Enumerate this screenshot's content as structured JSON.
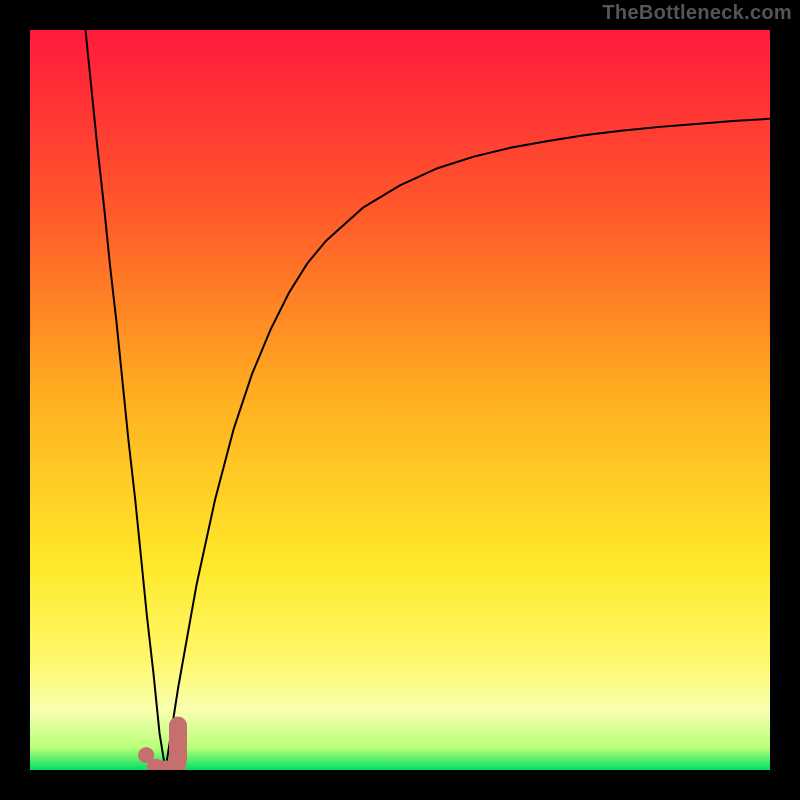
{
  "watermark": "TheBottleneck.com",
  "chart_data": {
    "type": "line",
    "title": "",
    "xlabel": "",
    "ylabel": "",
    "xlim": [
      0,
      100
    ],
    "ylim": [
      0,
      100
    ],
    "grid": false,
    "legend": false,
    "series": [
      {
        "name": "left-branch",
        "stroke": "#000000",
        "x": [
          7.5,
          8.3,
          9.1,
          10.0,
          10.8,
          11.7,
          12.5,
          13.3,
          14.2,
          15.0,
          15.8,
          16.7,
          17.5,
          18.3
        ],
        "values": [
          100,
          92.1,
          84.2,
          76.2,
          68.3,
          60.4,
          52.5,
          44.6,
          36.7,
          28.8,
          20.8,
          12.9,
          5.0,
          0.0
        ]
      },
      {
        "name": "right-curve",
        "stroke": "#000000",
        "x": [
          18.3,
          20.0,
          22.5,
          25.0,
          27.5,
          30.0,
          32.5,
          35.0,
          37.5,
          40.0,
          45.0,
          50.0,
          55.0,
          60.0,
          65.0,
          70.0,
          75.0,
          80.0,
          85.0,
          90.0,
          95.0,
          100.0
        ],
        "values": [
          0.0,
          11.0,
          25.0,
          36.5,
          46.0,
          53.5,
          59.5,
          64.5,
          68.5,
          71.5,
          76.0,
          79.0,
          81.3,
          82.9,
          84.1,
          85.0,
          85.8,
          86.4,
          86.9,
          87.3,
          87.7,
          88.0
        ]
      },
      {
        "name": "j-marker",
        "stroke": "#c76e6e",
        "x": [
          17.0,
          17.2,
          17.4,
          17.8,
          18.5,
          19.2,
          19.8,
          20.0,
          20.0,
          20.0,
          20.0
        ],
        "values": [
          0.3,
          0.2,
          0.1,
          0.05,
          0.05,
          0.1,
          0.5,
          1.5,
          3.0,
          4.5,
          6.0
        ]
      },
      {
        "name": "dot-marker",
        "stroke": "#c76e6e",
        "x": [
          15.7
        ],
        "values": [
          2.0
        ]
      }
    ],
    "background_gradient": {
      "stops": [
        {
          "offset": 0.0,
          "color": "#ff1a3c"
        },
        {
          "offset": 0.25,
          "color": "#ff5a2a"
        },
        {
          "offset": 0.5,
          "color": "#ffb020"
        },
        {
          "offset": 0.72,
          "color": "#ffe82a"
        },
        {
          "offset": 0.85,
          "color": "#fff86a"
        },
        {
          "offset": 0.92,
          "color": "#f8ffb0"
        },
        {
          "offset": 0.97,
          "color": "#b8ff7a"
        },
        {
          "offset": 1.0,
          "color": "#00e060"
        }
      ]
    }
  }
}
